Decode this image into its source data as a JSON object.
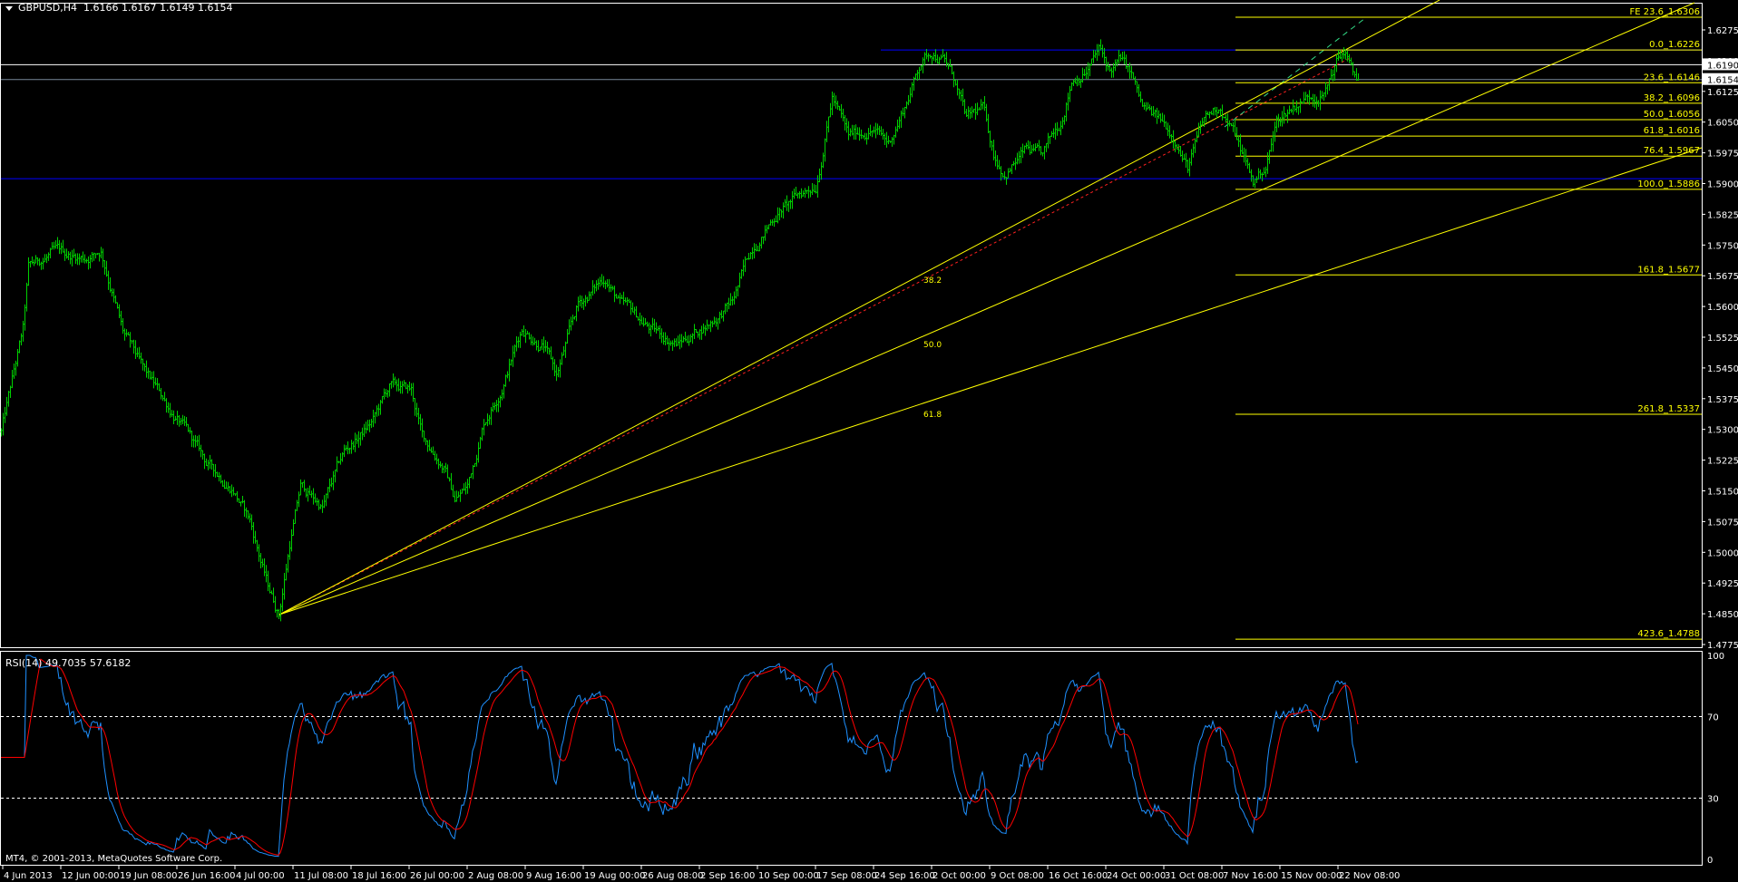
{
  "header": {
    "symbol": "GBPUSD,H4",
    "open": "1.6166",
    "high": "1.6167",
    "low": "1.6149",
    "close": "1.6154"
  },
  "rsi_header": "RSI(14) 49.7035 57.6182",
  "copyright": "MT4, © 2001-2013, MetaQuotes Software Corp.",
  "price_axis": [
    "1.6275",
    "1.6200",
    "1.6125",
    "1.6050",
    "1.5975",
    "1.5900",
    "1.5825",
    "1.5750",
    "1.5675",
    "1.5600",
    "1.5525",
    "1.5450",
    "1.5375",
    "1.5300",
    "1.5225",
    "1.5150",
    "1.5075",
    "1.5000",
    "1.4925",
    "1.4850",
    "1.4775"
  ],
  "price_boxes": [
    {
      "label": "1.6190",
      "price": 1.619
    },
    {
      "label": "1.6154",
      "price": 1.6154
    }
  ],
  "rsi_axis": [
    {
      "label": "100",
      "value": 100
    },
    {
      "label": "70",
      "value": 70
    },
    {
      "label": "30",
      "value": 30
    },
    {
      "label": "0",
      "value": 0
    }
  ],
  "time_axis": [
    "4 Jun 2013",
    "12 Jun 00:00",
    "19 Jun 08:00",
    "26 Jun 16:00",
    "4 Jul 00:00",
    "11 Jul 08:00",
    "18 Jul 16:00",
    "26 Jul 00:00",
    "2 Aug 08:00",
    "9 Aug 16:00",
    "19 Aug 00:00",
    "26 Aug 08:00",
    "2 Sep 16:00",
    "10 Sep 00:00",
    "17 Sep 08:00",
    "24 Sep 16:00",
    "2 Oct 00:00",
    "9 Oct 08:00",
    "16 Oct 16:00",
    "24 Oct 00:00",
    "31 Oct 08:00",
    "7 Nov 16:00",
    "15 Nov 00:00",
    "22 Nov 08:00"
  ],
  "fib_levels": [
    {
      "label": "FE 23.6_1.6306",
      "price": 1.6306
    },
    {
      "label": "0.0_1.6226",
      "price": 1.6226
    },
    {
      "label": "23.6_1.6146",
      "price": 1.6146
    },
    {
      "label": "38.2_1.6096",
      "price": 1.6096
    },
    {
      "label": "50.0_1.6056",
      "price": 1.6056
    },
    {
      "label": "61.8_1.6016",
      "price": 1.6016
    },
    {
      "label": "76.4_1.5967",
      "price": 1.5967
    },
    {
      "label": "100.0_1.5886",
      "price": 1.5886
    },
    {
      "label": "161.8_1.5677",
      "price": 1.5677
    },
    {
      "label": "261.8_1.5337",
      "price": 1.5337
    },
    {
      "label": "423.6_1.4788",
      "price": 1.4788
    }
  ],
  "fan_labels": [
    "38.2",
    "50.0",
    "61.8"
  ],
  "horizontal_lines": [
    {
      "price": 1.6226,
      "color": "#0000ff"
    },
    {
      "price": 1.5912,
      "color": "#0000ff"
    },
    {
      "price": 1.619,
      "color": "#ffffff"
    },
    {
      "price": 1.6154,
      "color": "#778899"
    }
  ],
  "colors": {
    "bars": "#00d000",
    "fib": "#ffff00",
    "rsi": "#1e90ff",
    "signal": "#ff0000",
    "axis": "#ffffff"
  },
  "chart_data": {
    "type": "ohlc",
    "symbol": "GBPUSD",
    "timeframe": "H4",
    "ylim": [
      1.4745,
      1.6345
    ],
    "bar_count": 749,
    "close_path": [
      [
        0,
        1.5294
      ],
      [
        12,
        1.5537
      ],
      [
        15,
        1.5686
      ],
      [
        27,
        1.5726
      ],
      [
        46,
        1.572
      ],
      [
        55,
        1.574
      ],
      [
        61,
        1.5645
      ],
      [
        67,
        1.5537
      ],
      [
        79,
        1.543
      ],
      [
        98,
        1.532
      ],
      [
        113,
        1.5213
      ],
      [
        128,
        1.516
      ],
      [
        137,
        1.5078
      ],
      [
        147,
        1.4916
      ],
      [
        153,
        1.485
      ],
      [
        159,
        1.5024
      ],
      [
        165,
        1.516
      ],
      [
        177,
        1.511
      ],
      [
        189,
        1.524
      ],
      [
        205,
        1.532
      ],
      [
        214,
        1.5402
      ],
      [
        226,
        1.539
      ],
      [
        232,
        1.528
      ],
      [
        244,
        1.5213
      ],
      [
        250,
        1.513
      ],
      [
        257,
        1.516
      ],
      [
        266,
        1.532
      ],
      [
        275,
        1.5402
      ],
      [
        287,
        1.555
      ],
      [
        299,
        1.551
      ],
      [
        306,
        1.543
      ],
      [
        318,
        1.56
      ],
      [
        333,
        1.5672
      ],
      [
        342,
        1.56
      ],
      [
        360,
        1.5537
      ],
      [
        373,
        1.551
      ],
      [
        382,
        1.5537
      ],
      [
        391,
        1.5565
      ],
      [
        403,
        1.561
      ],
      [
        415,
        1.5753
      ],
      [
        428,
        1.5834
      ],
      [
        437,
        1.586
      ],
      [
        449,
        1.59
      ],
      [
        458,
        1.6118
      ],
      [
        467,
        1.601
      ],
      [
        480,
        1.6037
      ],
      [
        489,
        1.5997
      ],
      [
        498,
        1.609
      ],
      [
        507,
        1.62
      ],
      [
        513,
        1.6226
      ],
      [
        519,
        1.621
      ],
      [
        525,
        1.6159
      ],
      [
        532,
        1.605
      ],
      [
        541,
        1.6078
      ],
      [
        547,
        1.597
      ],
      [
        553,
        1.593
      ],
      [
        565,
        1.598
      ],
      [
        574,
        1.5956
      ],
      [
        584,
        1.605
      ],
      [
        590,
        1.6159
      ],
      [
        599,
        1.6186
      ],
      [
        605,
        1.6226
      ],
      [
        611,
        1.6172
      ],
      [
        617,
        1.62
      ],
      [
        623,
        1.6159
      ],
      [
        629,
        1.6078
      ],
      [
        638,
        1.605
      ],
      [
        648,
        1.601
      ],
      [
        654,
        1.5943
      ],
      [
        663,
        1.605
      ],
      [
        672,
        1.609
      ],
      [
        681,
        1.601
      ],
      [
        690,
        1.59
      ],
      [
        697,
        1.5943
      ],
      [
        703,
        1.605
      ],
      [
        712,
        1.609
      ],
      [
        721,
        1.6118
      ],
      [
        730,
        1.613
      ],
      [
        736,
        1.62
      ],
      [
        741,
        1.6226
      ],
      [
        745,
        1.6159
      ],
      [
        748,
        1.6154
      ]
    ],
    "rsi_period": 14,
    "rsi_levels": [
      70,
      30
    ],
    "rsi_ylim": [
      0,
      100
    ]
  }
}
